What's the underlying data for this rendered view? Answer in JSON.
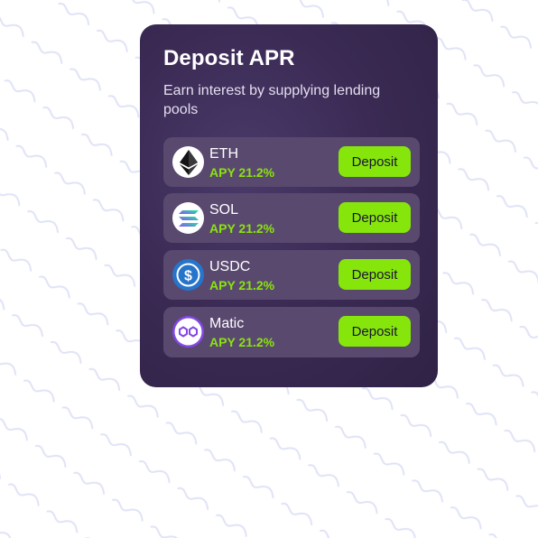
{
  "card": {
    "title": "Deposit APR",
    "subtitle": "Earn interest by supplying lending pools"
  },
  "pools": [
    {
      "name": "ETH",
      "apy": "APY 21.2%",
      "button": "Deposit",
      "icon": "ethereum-icon"
    },
    {
      "name": "SOL",
      "apy": "APY 21.2%",
      "button": "Deposit",
      "icon": "solana-icon"
    },
    {
      "name": "USDC",
      "apy": "APY 21.2%",
      "button": "Deposit",
      "icon": "usdc-icon"
    },
    {
      "name": "Matic",
      "apy": "APY 21.2%",
      "button": "Deposit",
      "icon": "polygon-icon"
    }
  ],
  "colors": {
    "card_bg": "#3b2b55",
    "row_bg": "#59496f",
    "accent_green": "#86e60b",
    "apy_text": "#8be30e",
    "usdc_blue": "#2775ca",
    "polygon_purple": "#8247e5"
  }
}
